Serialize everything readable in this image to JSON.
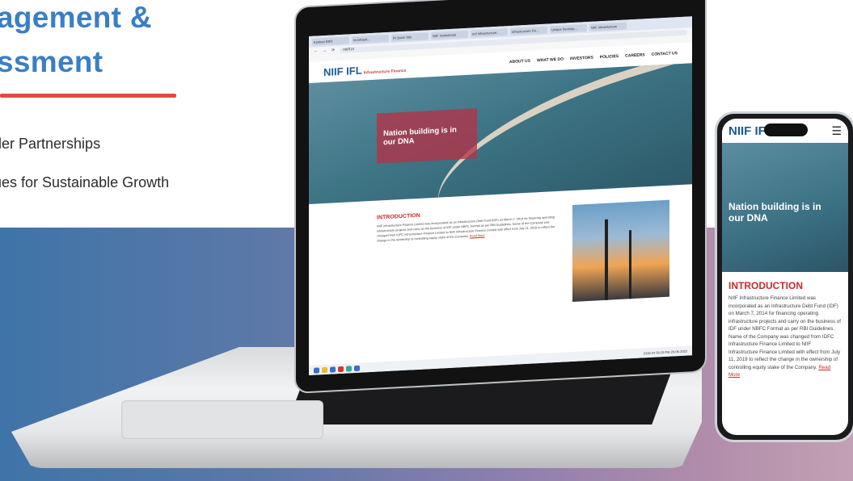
{
  "slide": {
    "heading_line1": "agement &",
    "heading_line2": "ssment",
    "bullets": [
      "der Partnerships",
      "ues for Sustainable Growth"
    ]
  },
  "colors": {
    "heading": "#3a7fc6",
    "accent_red": "#e14a44"
  },
  "laptop": {
    "browser": {
      "tabs": [
        "Kanban BRD",
        "Ni Infrastr...",
        "Pt Stock Title",
        "NIIF Institutional",
        "eof Infrastructure...",
        "Infrastructure Fin...",
        "Unique Develop...",
        "NIIF Infrastructure"
      ],
      "address": "niiifl.in"
    },
    "site": {
      "logo": "NIIF IFL",
      "logo_sub": "Infrastructure Finance",
      "nav": [
        "ABOUT US",
        "WHAT WE DO",
        "INVESTORS",
        "POLICIES",
        "CAREERS",
        "CONTACT US"
      ],
      "hero_text": "Nation building is in our DNA",
      "intro_title": "INTRODUCTION",
      "intro_text": "NIIF Infrastructure Finance Limited was incorporated as an Infrastructure Debt Fund (IDF) on March 7, 2014 for financing operating infrastructure projects and carry on the business of IDF under NBFC Format as per RBI Guidelines. Name of the Company was changed from IDFC Infrastructure Finance Limited to NIIF Infrastructure Finance Limited with effect from July 11, 2019 to reflect the change in the ownership of controlling equity stake of the Company.",
      "read_more": "Read More"
    },
    "taskbar": {
      "time": "09:15 PM",
      "date": "29-06-2023",
      "lang": "ENG IN"
    }
  },
  "phone": {
    "logo": "NIIF IFL",
    "menu_icon": "hamburger-icon",
    "hero_text": "Nation building is in our DNA",
    "intro_title": "INTRODUCTION",
    "intro_text": "NIIF Infrastructure Finance Limited was incorporated as an Infrastructure Debt Fund (IDF) on March 7, 2014 for financing operating infrastructure projects and carry on the business of IDF under NBFC Format as per RBI Guidelines. Name of the Company was changed from IDFC Infrastructure Finance Limited to NIIF Infrastructure Finance Limited with effect from July 11, 2019 to reflect the change in the ownership of controlling equity stake of the Company.",
    "read_more": "Read More"
  }
}
